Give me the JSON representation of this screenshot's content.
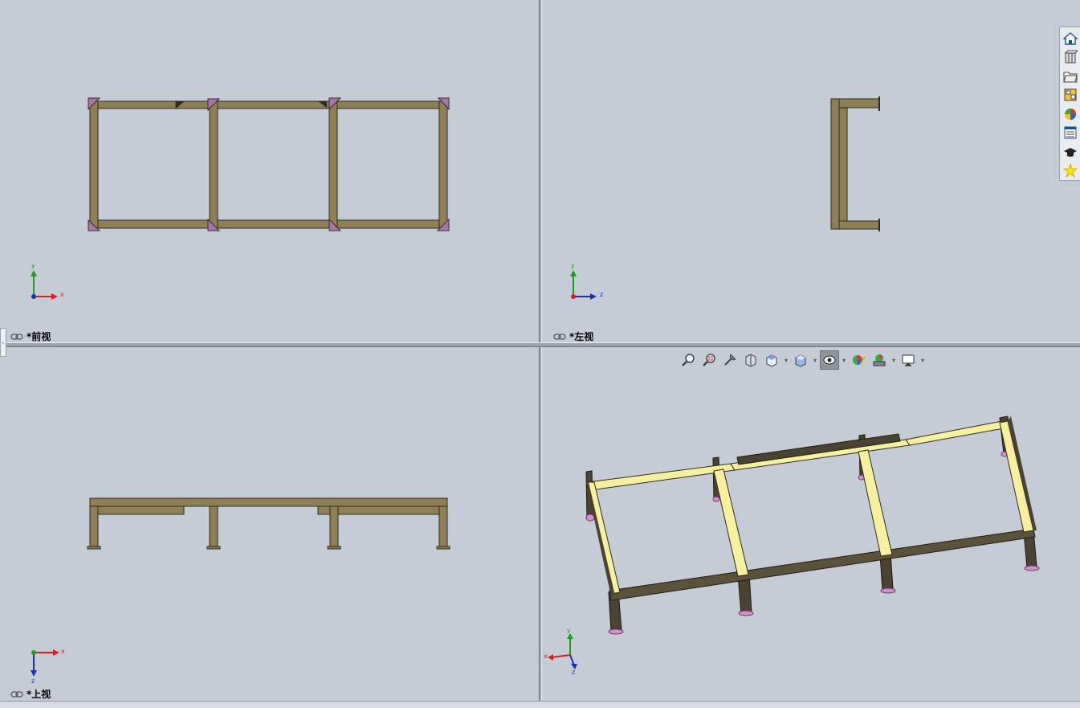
{
  "viewports": {
    "front": {
      "label": "*前视",
      "axis_h": "x",
      "axis_v": "y"
    },
    "left": {
      "label": "*左视",
      "axis_h": "z",
      "axis_v": "y"
    },
    "top": {
      "label": "*上视",
      "axis_h": "x",
      "axis_v": "z"
    },
    "iso": {
      "axis_a": "x",
      "axis_b": "y",
      "axis_c": "z"
    }
  },
  "task_pane_icons": [
    "home-icon",
    "parts-library-icon",
    "folder-icon",
    "view-palette-icon",
    "appearance-icon",
    "custom-properties-icon",
    "learning-icon",
    "favorites-star-icon"
  ],
  "heads_up_toolbar_icons": [
    "zoom-to-fit-icon",
    "zoom-area-icon",
    "previous-view-icon",
    "section-view-icon",
    "view-orientation-icon",
    "display-style-icon",
    "hide-show-icon",
    "edit-appearance-icon",
    "apply-scene-icon",
    "view-settings-icon"
  ],
  "colors": {
    "frame_brown": "#8e7f54",
    "frame_highlight": "#f6f0a0",
    "frame_dark": "#4a4232",
    "gusset_purple": "#a676a8",
    "background": "#c6ccd5"
  }
}
